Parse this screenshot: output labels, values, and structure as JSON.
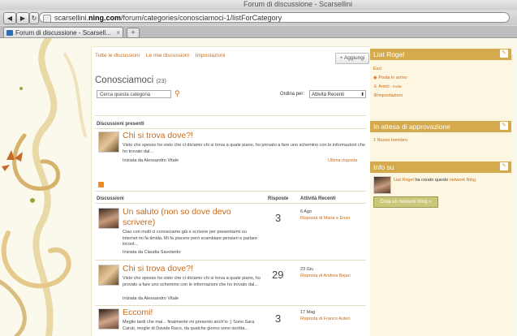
{
  "browser": {
    "window_title": "Forum di discussione - Scarsellini",
    "url_prefix": "scarsellini.",
    "url_domain": "ning.com",
    "url_path": "/forum/categories/conosciamoci-1/listForCategory",
    "tab_title": "Forum di discussione - Scarsell...",
    "back": "◀",
    "forward": "▶",
    "new_tab": "+"
  },
  "nav": {
    "all_discussions": "Tutte le discussioni",
    "my_discussions": "Le mie discussioni",
    "settings": "Impostazioni",
    "add_button": "+ Aggiungi"
  },
  "category": {
    "title": "Conosciamoci",
    "count": "(23)",
    "search_placeholder": "Cerca questa categoria",
    "order_label": "Ordina per:",
    "order_value": "Attività Recenti"
  },
  "featured": {
    "header": "Discussioni presenti",
    "title": "Chi si trova dove?!",
    "excerpt": "Visto che spesso ho visto che ci diciamo chi si trova a quale piano, ho provato a fare uno schemino con le informazioni che ho trovato dal...",
    "byline": "Iniziata da Alessandro Vitale",
    "latest_reply": "Ultima risposta"
  },
  "table": {
    "col_discussions": "Discussioni",
    "col_replies": "Risposte",
    "col_activity": "Attività Recenti"
  },
  "discussions": [
    {
      "title_line1": "Un saluto (non so dove devo",
      "title_line2": "scrivere)",
      "excerpt": "Ciao con molti ci conosciamo già e scrivere per presentarmi su internet mi fa timida. Mi fa piacere però scambiare pensieri e parlare incont...",
      "byline": "Iniziata da Claudia Savolardo",
      "replies": "3",
      "date": "6 Ago",
      "reply_by": "Risposta di Maria e Enzo"
    },
    {
      "title_line1": "Chi si trova dove?!",
      "title_line2": "",
      "excerpt": "Visto che spesso ho visto che ci diciamo chi si trova a quale piano, ho provato a fare uno schemino con le informazioni che ho trovato dal...",
      "byline": "Iniziata da Alessandro Vitale",
      "replies": "29",
      "date": "23 Giu",
      "reply_by": "Risposta di Andrea Bejan"
    },
    {
      "title_line1": "Eccomi!",
      "title_line2": "",
      "excerpt": "Meglio tardi che mai... finalmente mi presento anch'io ;) Sono Sara Caruti, moglie di Davide Raco, da qualche giorno sono iscritta...",
      "byline": "",
      "replies": "3",
      "date": "17 Mag",
      "reply_by": "Risposta di Franco Auteri"
    }
  ],
  "sidebar": {
    "user_box_title": "Liat Rogel",
    "exit": "Esci",
    "inbox": "Posta in arrivo",
    "friends": "Amici",
    "friends_invite": "- Invita",
    "settings": "Impostazioni",
    "pending_title": "In attesa di approvazione",
    "new_members": "1 Nuovo membro",
    "info_title": "Info su",
    "info_user": "Liat Rogel",
    "info_text": "ha creato questo",
    "info_link": "network Ning.",
    "create_button": "Crea un network Ning »",
    "edit_icon": "✎"
  },
  "colors": {
    "accent": "#c86b1b",
    "sidebar_bar": "#d4aa4d",
    "page_bg": "#fbf8ec"
  }
}
